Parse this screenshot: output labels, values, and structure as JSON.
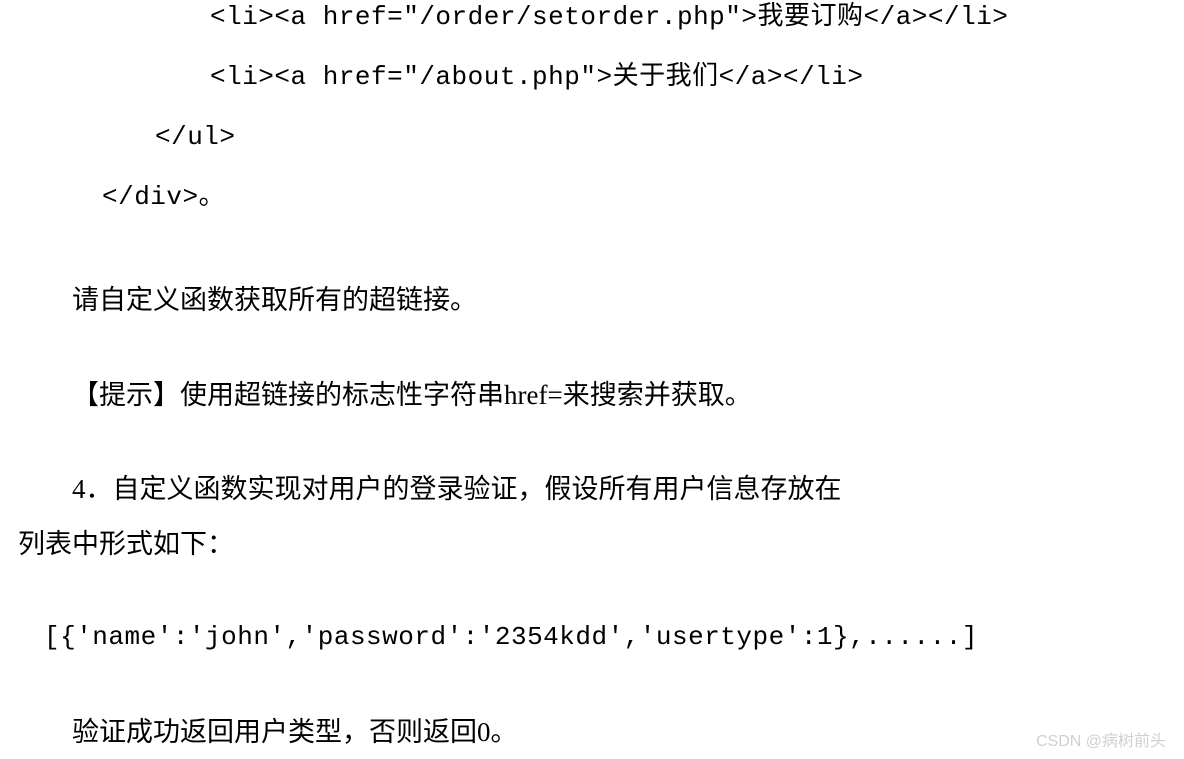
{
  "code": {
    "line1": "<li><a href=\"/order/setorder.php\">我要订购</a></li>",
    "line2": "<li><a href=\"/about.php\">关于我们</a></li>",
    "line3": "</ul>",
    "line4": "</div>。",
    "line5": "[{'name':'john','password':'2354kdd','usertype':1},......]"
  },
  "paragraphs": {
    "p1": "请自定义函数获取所有的超链接。",
    "p2": "【提示】使用超链接的标志性字符串href=来搜索并获取。",
    "p3a": "4．自定义函数实现对用户的登录验证，假设所有用户信息存放在",
    "p3b": "列表中形式如下：",
    "p4": "验证成功返回用户类型，否则返回0。"
  },
  "watermark": "CSDN @病树前头"
}
